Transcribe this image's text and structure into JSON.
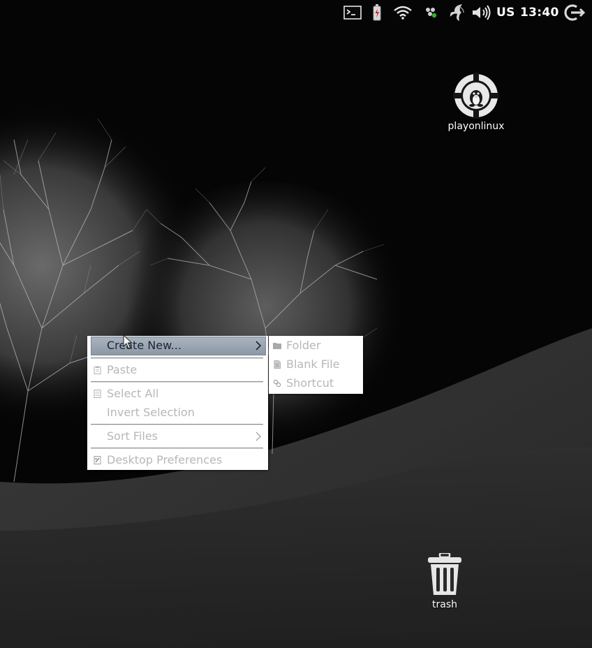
{
  "tray": {
    "keyboard_layout": "US",
    "clock": "13:40",
    "icons": [
      "terminal-icon",
      "battery-icon",
      "wifi-icon",
      "network-status-icon",
      "app-swirl-icon",
      "volume-icon",
      "power-icon"
    ]
  },
  "desktop_icons": {
    "playonlinux": {
      "label": "playonlinux"
    },
    "trash": {
      "label": "trash"
    }
  },
  "context_menu": {
    "create_new": "Create New...",
    "paste": "Paste",
    "select_all": "Select All",
    "invert_selection": "Invert Selection",
    "sort_files": "Sort Files",
    "desktop_preferences": "Desktop Preferences"
  },
  "submenu": {
    "folder": "Folder",
    "blank_file": "Blank File",
    "shortcut": "Shortcut"
  },
  "colors": {
    "menu_bg": "#ffffff",
    "menu_disabled_text": "#b7b7b7",
    "highlight": "#9aa6b3",
    "tray_text": "#ffffff"
  }
}
